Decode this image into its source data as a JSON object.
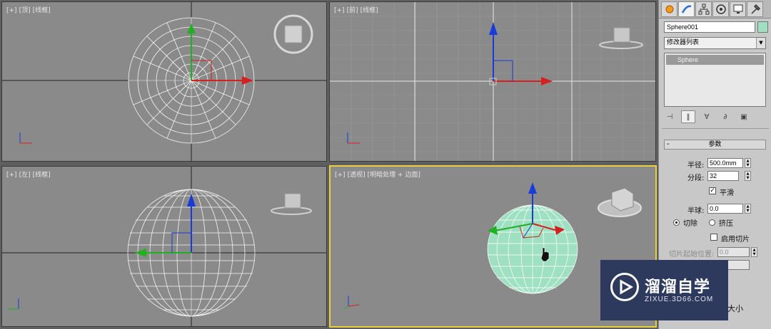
{
  "viewports": {
    "top": {
      "tags": [
        "[+]",
        "[顶]",
        "[线框]"
      ]
    },
    "front": {
      "tags": [
        "[+]",
        "[前]",
        "[线框]"
      ]
    },
    "left": {
      "tags": [
        "[+]",
        "[左]",
        "[线框]"
      ]
    },
    "perspective": {
      "tags": [
        "[+]",
        "[透视]",
        "[明暗处理 + 边面]"
      ]
    }
  },
  "panel": {
    "tabs": [
      "create-icon",
      "modify-icon",
      "hierarchy-icon",
      "motion-icon",
      "display-icon",
      "utilities-icon"
    ],
    "object_name": "Sphere001",
    "object_color": "#9fe0c2",
    "modifier_list": "修改器列表",
    "stack_items": [
      "Sphere"
    ],
    "rollout_title": "参数",
    "radius_label": "半径:",
    "radius_value": "500.0mm",
    "segments_label": "分段:",
    "segments_value": "32",
    "smooth_label": "平滑",
    "hemisphere_label": "半球:",
    "hemisphere_value": "0.0",
    "chop_label": "切除",
    "squash_label": "挤压",
    "slice_on_label": "启用切片",
    "slice_from_label": "切片起始位置:",
    "slice_from_value": "0.0",
    "size_label_fragment": "大小"
  },
  "watermark": {
    "title": "溜溜自学",
    "url": "ZIXUE.3D66.COM"
  },
  "colors": {
    "active_border": "#e9d03c",
    "sphere_shaded": "#9fe0c2",
    "axis_x": "#d42020",
    "axis_y": "#20b020",
    "axis_z": "#1a3bd8"
  }
}
